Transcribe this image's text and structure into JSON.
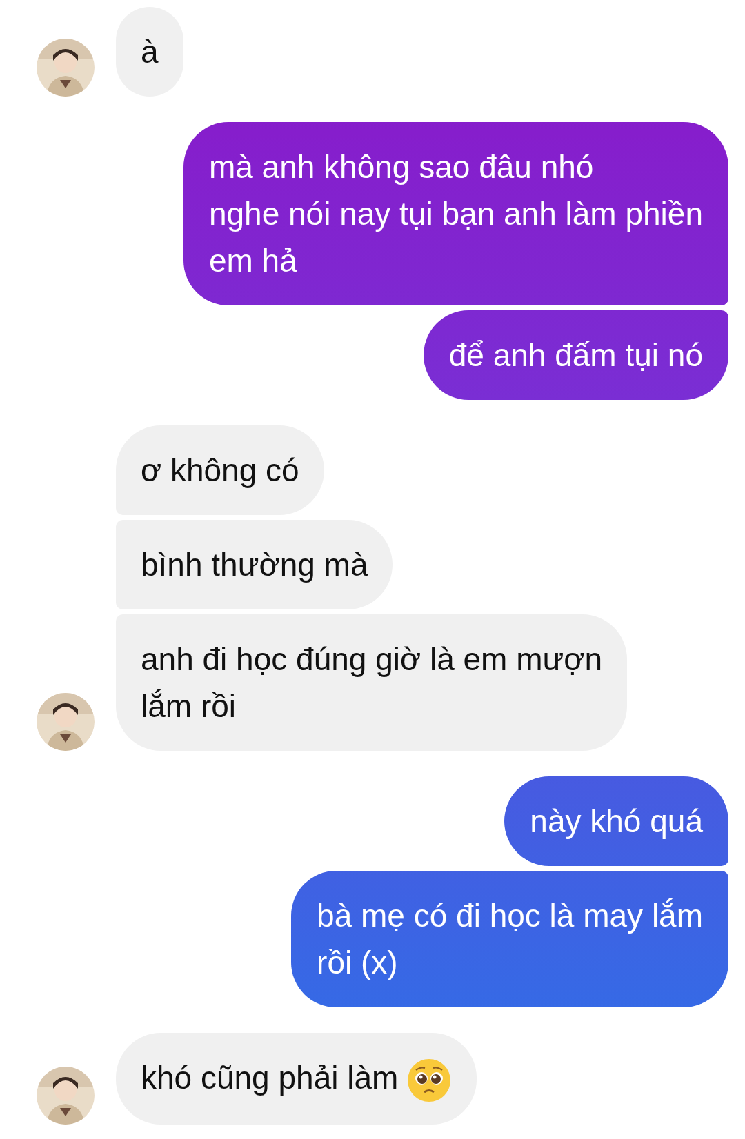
{
  "groups": [
    {
      "kind": "received",
      "messages": [
        {
          "kind": "text",
          "lines": [
            "à"
          ]
        }
      ]
    },
    {
      "kind": "sent",
      "messages": [
        {
          "kind": "text",
          "lines": [
            "mà anh không sao đâu nhó",
            "nghe nói nay tụi bạn anh làm phiền",
            "em hả"
          ]
        },
        {
          "kind": "text",
          "lines": [
            "để anh đấm tụi nó"
          ]
        }
      ]
    },
    {
      "kind": "received",
      "messages": [
        {
          "kind": "text",
          "lines": [
            "ơ không có"
          ]
        },
        {
          "kind": "text",
          "lines": [
            "bình thường mà"
          ]
        },
        {
          "kind": "text",
          "lines": [
            "anh đi học đúng giờ là em mượn",
            "lắm rồi"
          ]
        }
      ]
    },
    {
      "kind": "sent",
      "messages": [
        {
          "kind": "text",
          "lines": [
            "này khó quá"
          ]
        },
        {
          "kind": "text",
          "lines": [
            "bà mẹ có đi học là may lắm",
            "rồi (x)"
          ]
        }
      ]
    },
    {
      "kind": "received",
      "messages": [
        {
          "kind": "emoji_text",
          "lines": [
            "khó cũng phải làm"
          ]
        }
      ]
    }
  ]
}
